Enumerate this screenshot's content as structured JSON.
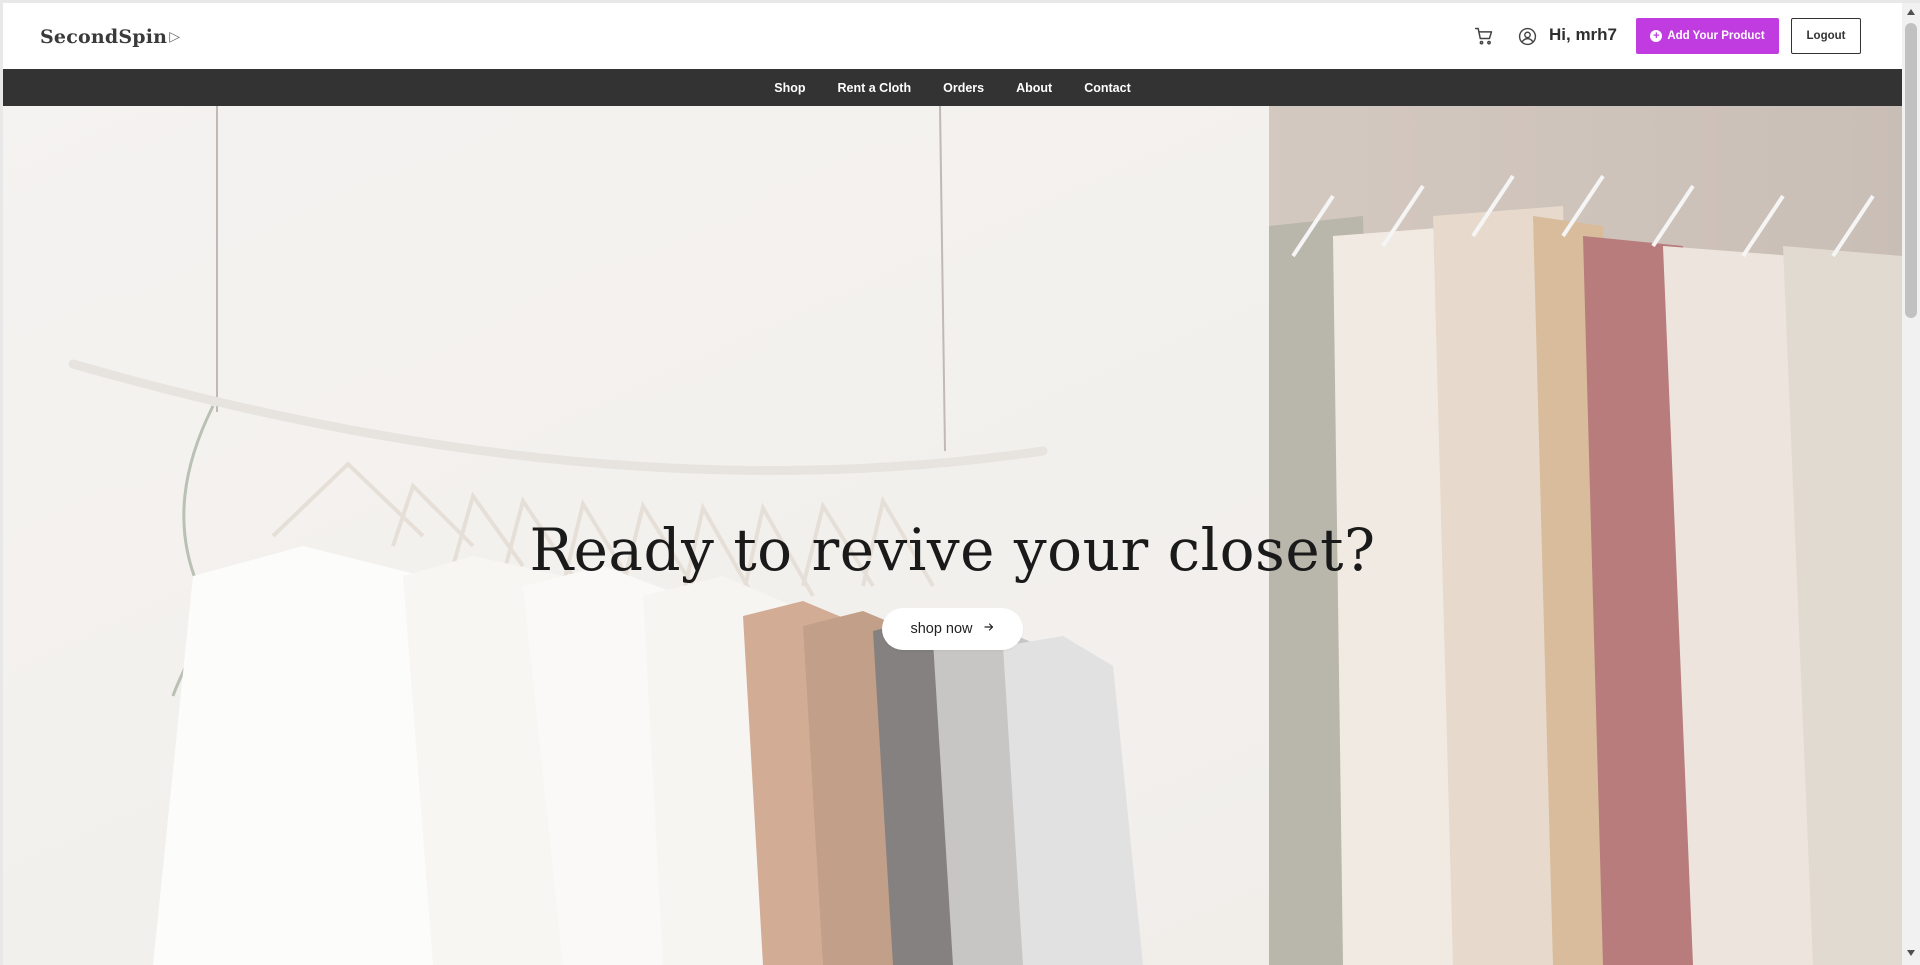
{
  "header": {
    "logo_text": "SecondSpin",
    "greeting": "Hi, mrh7",
    "add_product_label": "Add Your Product",
    "logout_label": "Logout"
  },
  "nav": {
    "items": [
      "Shop",
      "Rent a Cloth",
      "Orders",
      "About",
      "Contact"
    ]
  },
  "hero": {
    "title": "Ready to revive your closet?",
    "button_label": "shop now",
    "button_icon": "arrow-right-icon"
  },
  "colors": {
    "accent": "#c13ce0",
    "nav_bg": "#333333",
    "hero_text": "#1a1a1a"
  }
}
